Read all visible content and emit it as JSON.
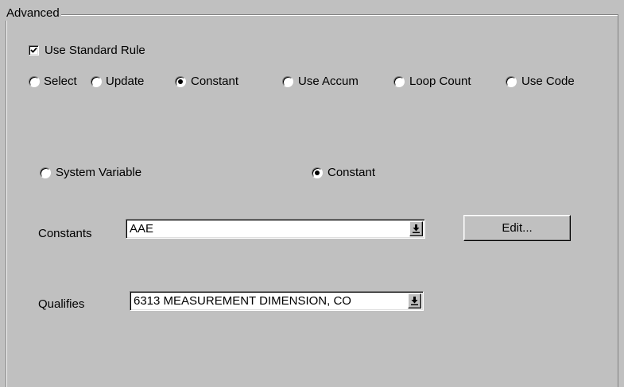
{
  "group": {
    "title": "Advanced"
  },
  "use_standard_rule": {
    "label": "Use Standard Rule",
    "checked": true
  },
  "rule_types": [
    {
      "label": "Select",
      "checked": false
    },
    {
      "label": "Update",
      "checked": false
    },
    {
      "label": "Constant",
      "checked": true
    },
    {
      "label": "Use Accum",
      "checked": false
    },
    {
      "label": "Loop Count",
      "checked": false
    },
    {
      "label": "Use Code",
      "checked": false
    }
  ],
  "source": {
    "system_variable_label": "System Variable",
    "system_variable_checked": false,
    "constant_label": "Constant",
    "constant_checked": true
  },
  "constants": {
    "label": "Constants",
    "value": "AAE",
    "edit_label": "Edit..."
  },
  "qualifies": {
    "label": "Qualifies",
    "value": "6313 MEASUREMENT DIMENSION, CO"
  }
}
